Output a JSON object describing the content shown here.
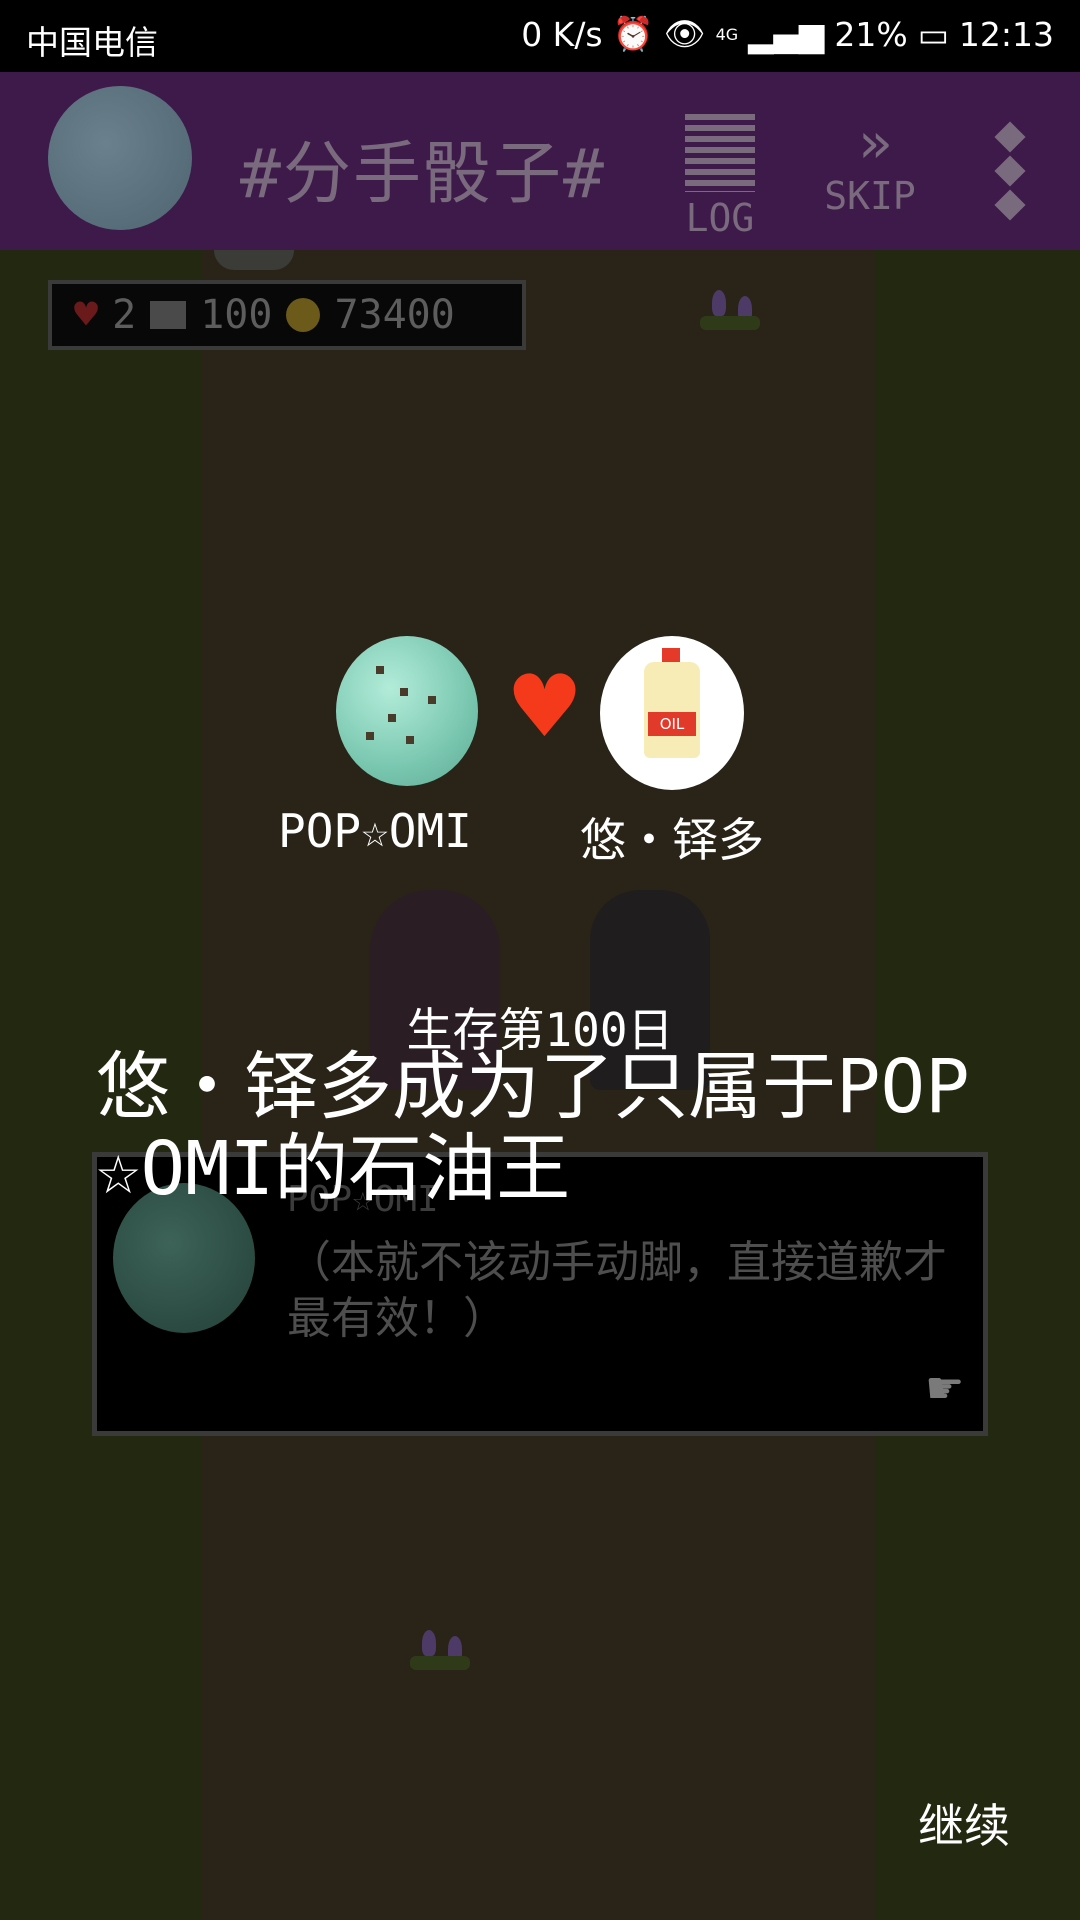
{
  "status_bar": {
    "carrier": "中国电信",
    "net_speed": "0 K/s",
    "signal": "4G",
    "battery": "21%",
    "time": "12:13"
  },
  "topbar": {
    "title": "#分手骰子#",
    "log_label": "LOG",
    "skip_label": "SKIP"
  },
  "hud": {
    "hearts": "2",
    "cards": "100",
    "coins": "73400"
  },
  "pair": {
    "player1_name": "POP☆OMI",
    "player2_name": "悠・铎多",
    "bottle_label": "OIL"
  },
  "event": {
    "day_text": "生存第100日",
    "headline": "悠・铎多成为了只属于POP☆OMI的石油王"
  },
  "dialog": {
    "speaker": "POP☆OMI",
    "text": "（本就不该动手动脚，直接道歉才最有效！）"
  },
  "continue_label": "继续"
}
